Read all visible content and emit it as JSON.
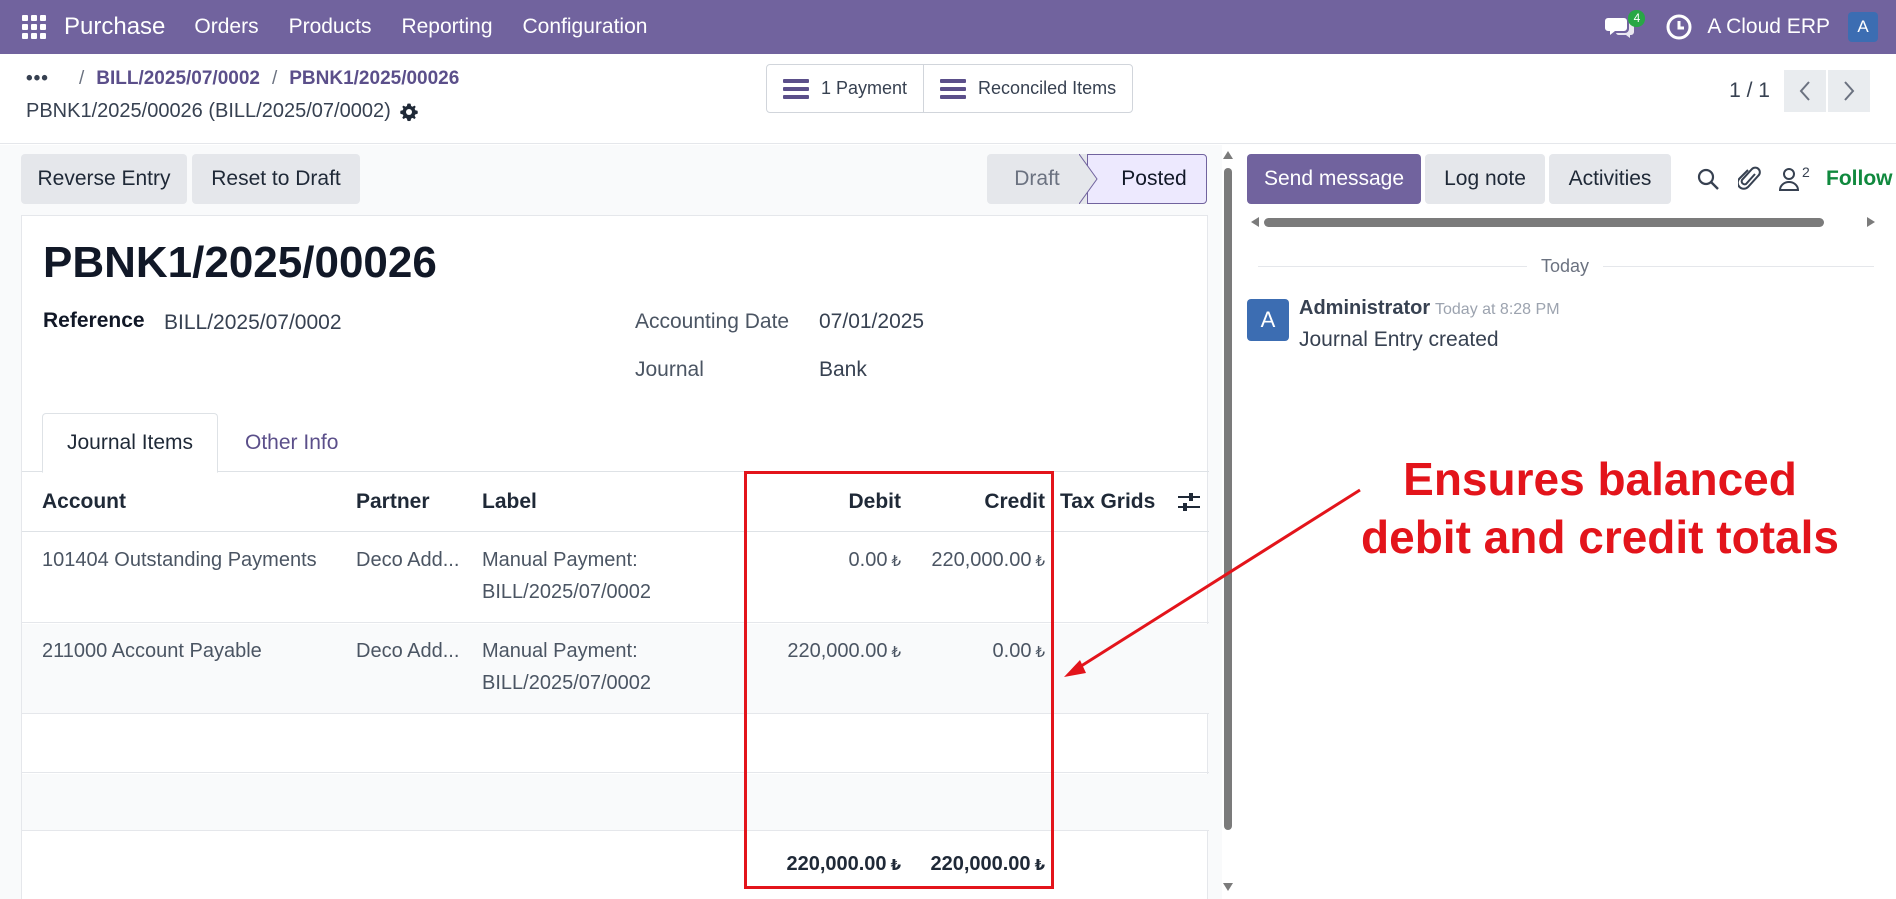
{
  "navbar": {
    "app_name": "Purchase",
    "menu": [
      "Orders",
      "Products",
      "Reporting",
      "Configuration"
    ],
    "messages_badge": "4",
    "company": "A Cloud ERP",
    "user_initial": "A",
    "color": "#71639e"
  },
  "breadcrumb": {
    "dots": "•••",
    "items": [
      "BILL/2025/07/0002",
      "PBNK1/2025/00026"
    ]
  },
  "record": {
    "title": "PBNK1/2025/00026 (BILL/2025/07/0002)"
  },
  "smart_buttons": {
    "payment": "1 Payment",
    "reconciled": "Reconciled Items"
  },
  "pager": {
    "value": "1 / 1"
  },
  "actions": {
    "reverse": "Reverse Entry",
    "reset": "Reset to Draft"
  },
  "status": {
    "draft": "Draft",
    "posted": "Posted",
    "current": "Posted"
  },
  "form": {
    "name": "PBNK1/2025/00026",
    "reference_label": "Reference",
    "reference_value": "BILL/2025/07/0002",
    "accounting_date_label": "Accounting Date",
    "accounting_date_value": "07/01/2025",
    "journal_label": "Journal",
    "journal_value": "Bank"
  },
  "tabs": {
    "journal_items": "Journal Items",
    "other_info": "Other Info"
  },
  "table": {
    "headers": {
      "account": "Account",
      "partner": "Partner",
      "label": "Label",
      "debit": "Debit",
      "credit": "Credit",
      "tax_grids": "Tax Grids"
    },
    "currency_symbol": "₺",
    "rows": [
      {
        "account": "101404 Outstanding Payments",
        "partner": "Deco Add...",
        "label_line1": "Manual Payment:",
        "label_line2": "BILL/2025/07/0002",
        "debit": "0.00",
        "credit": "220,000.00"
      },
      {
        "account": "211000 Account Payable",
        "partner": "Deco Add...",
        "label_line1": "Manual Payment:",
        "label_line2": "BILL/2025/07/0002",
        "debit": "220,000.00",
        "credit": "0.00"
      }
    ],
    "totals": {
      "debit": "220,000.00",
      "credit": "220,000.00"
    }
  },
  "chatter": {
    "send_message": "Send message",
    "log_note": "Log note",
    "activities": "Activities",
    "followers_count": "2",
    "follow": "Follow",
    "date_separator": "Today",
    "messages": [
      {
        "avatar": "A",
        "author": "Administrator",
        "time": "Today at 8:28 PM",
        "body": "Journal Entry created"
      }
    ]
  },
  "annotation": {
    "line1": "Ensures balanced",
    "line2": "debit and credit totals",
    "color": "#e3141b"
  }
}
